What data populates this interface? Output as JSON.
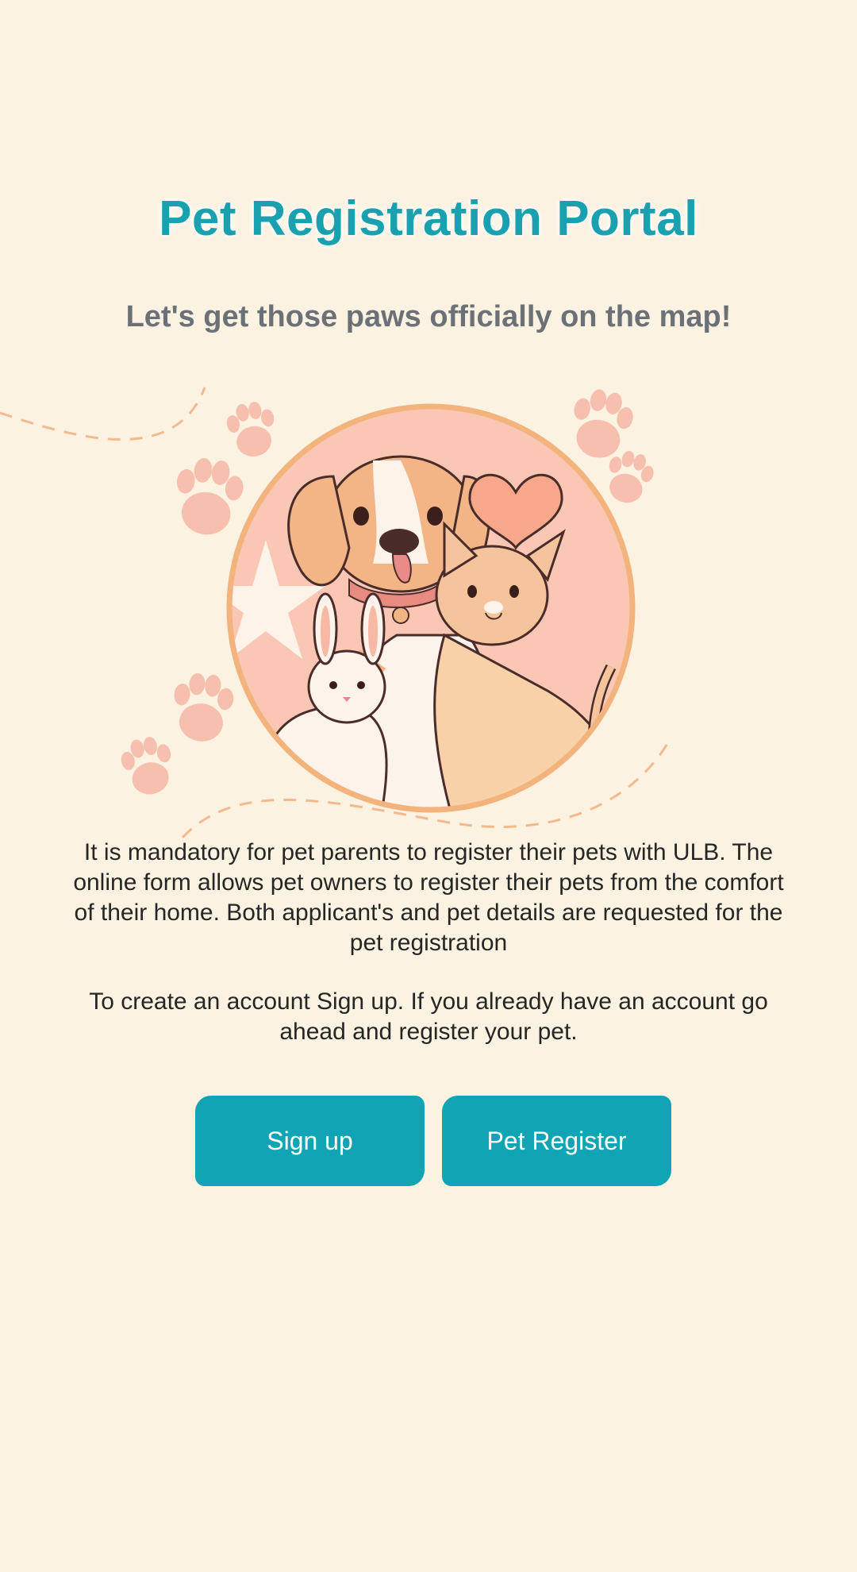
{
  "header": {
    "title": "Pet Registration Portal",
    "subtitle": "Let's get those paws officially on the map!"
  },
  "hero": {
    "illustration": "dog-cat-rabbit-illustration",
    "decorations": [
      "paw-print-icon",
      "heart-icon",
      "star-icon"
    ]
  },
  "content": {
    "description": "It is mandatory for pet parents to register their pets with ULB. The online form allows pet owners to register their pets from the comfort of their home. Both applicant's and pet details are requested for the pet registration",
    "instruction": "To create an account Sign up. If you already have an account go ahead and register your pet."
  },
  "actions": {
    "signup_label": "Sign up",
    "register_label": "Pet Register"
  },
  "colors": {
    "background": "#fcf2e1",
    "accent": "#10a4b4",
    "title": "#19a1b0",
    "subtitle": "#6b7177",
    "paw": "#f7bfae",
    "circle_border": "#f3b37d"
  }
}
